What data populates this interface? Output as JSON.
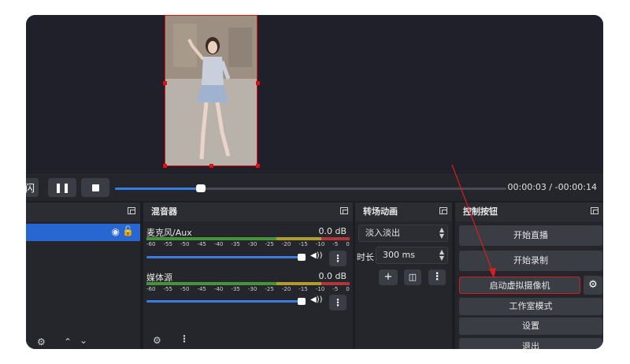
{
  "player": {
    "partial_label": "闪",
    "time": "00:00:03 / -00:00:14",
    "progress_fraction": 0.22
  },
  "sources_dock": {
    "lock_icon": "lock-icon",
    "eye_icon": "eye-icon"
  },
  "mixer": {
    "title": "混音器",
    "channels": [
      {
        "name": "麦克风/Aux",
        "db": "0.0 dB"
      },
      {
        "name": "媒体源",
        "db": "0.0 dB"
      }
    ],
    "scale": [
      "-60",
      "-55",
      "-50",
      "-45",
      "-40",
      "-35",
      "-30",
      "-25",
      "-20",
      "-15",
      "-10",
      "-5",
      "0"
    ]
  },
  "transitions": {
    "title": "转场动画",
    "selected": "淡入淡出",
    "duration_label": "时长",
    "duration_value": "300 ms"
  },
  "controls": {
    "title": "控制按钮",
    "start_stream": "开始直播",
    "start_record": "开始录制",
    "virtual_camera": "启动虚拟摄像机",
    "studio_mode": "工作室模式",
    "settings": "设置",
    "exit": "退出"
  },
  "colors": {
    "highlight_red": "#d81e1e",
    "accent_blue": "#3a7de0",
    "panel_bg": "#25262b"
  }
}
